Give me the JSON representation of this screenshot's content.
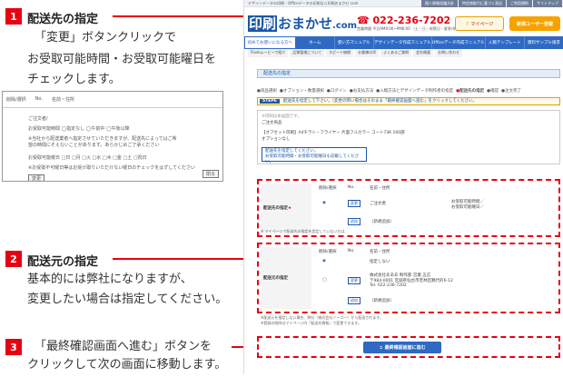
{
  "annotations": [
    {
      "num": "1",
      "title": "配送先の指定",
      "lines": [
        "「変更」ボタンクリックで",
        "お受取可能時間・お受取可能曜日を",
        "チェックします。"
      ]
    },
    {
      "num": "2",
      "title": "配送元の指定",
      "lines": [
        "基本的には弊社になりますが、",
        "変更したい場合は指定してください。"
      ]
    },
    {
      "num": "3",
      "title": "",
      "lines": [
        "「最終確認画面へ進む」ボタンを",
        "クリックして次の画面に移動します。"
      ]
    }
  ],
  "inset": {
    "col1": "削除/選択",
    "col2": "No.",
    "col3": "名前・住所",
    "row1": "ご注文者/",
    "row2": "お受取可能時間 ◯指定なし ◯午前中 ◯午後以降",
    "row3": "※当社から配送業者へ指定させていただきますが、配送先によってはご希望の時間にそえないことがあります。あらかじめご了承ください",
    "row4": "お受取可能曜日 □日 □月 □火 □水 □木 □金 □土 □祝日",
    "row5": "※お受取不可曜日等はお受け取りいただけない曜日のチェックをはずしてください",
    "btn_change": "変更",
    "btn_close": "閉る"
  },
  "shot": {
    "topbar_text": "デザインデータの印刷・Officeデータの印刷なら印刷おまかせ.com",
    "toplinks": [
      "個人情報保護方針",
      "特定商取引に基づく表記",
      "ご利用規約",
      "サイトマップ"
    ],
    "logo_box": "印刷",
    "logo_text": "おまかせ",
    "logo_tld": ".com",
    "tel": "022-236-7202",
    "tel_sub": "営業時間 平日AM9:00~PM6:00 （土・日・祝祭日・夏季/年末年始休業を除く）",
    "mypage": "マイページ",
    "register": "新規ユーザー登録",
    "nav": [
      "初めてお使いになる方へ",
      "ホーム",
      "使い方マニュアル",
      "デザインデータ作成マニュアル",
      "Officeデータ作成マニュアル",
      "入稿テンプレート",
      "資料サンプル請求"
    ],
    "subnav": [
      "Flashムービーで紹介",
      "品質管理について",
      "スピード納期",
      "お客様の声",
      "よくあるご質問",
      "会社概要",
      "お問い合わせ"
    ],
    "section_title": "配送先の指定",
    "steps": [
      "商品選択",
      "オプション・数量選択",
      "ログイン",
      "お支払方法",
      "入稿方法とデザインデータ制作者の指定",
      "配送先の指定",
      "確認",
      "注文完了"
    ],
    "step_current_index": 5,
    "step_label": "STEP6",
    "step_text": "配送先を指定して下さい。（変更の際い場合はそのまま「最終確認画面へ進む」をクリックしてください。",
    "prod_note": "※印刷は本画面です。",
    "prod_label": "ご注文商品",
    "prod_line1": "【オフセット印刷】A4チラシ・フライヤー 片面フルカラー コート73K 100部",
    "prod_line2": "オプションなし",
    "warn1": "配送先を指定してください。",
    "warn2": "お受取可能時間・お受取可能曜日も記載してください。",
    "dest_label": "配送先の指定",
    "dest_col1": "削除/選択",
    "dest_col2": "No.",
    "dest_col3": "名前・住所",
    "dest_name": "ご注文者",
    "dest_time": "お受取可能時間／",
    "dest_day": "お受取可能曜日／",
    "change": "変更",
    "add": "追加",
    "add_note": "（新規追加）",
    "dest_note": "※ マイページで配送先の指定を設定していない方は、",
    "src_label": "配送元の指定",
    "src_none": "指定しない",
    "src_company": "株式会社あああ 制作部 営業 五広",
    "src_addr": "〒984-0001 宮城県仙台市若林区鶴代町6-12",
    "src_tel": "Tel. 022-236-7202",
    "src_note1": "※配送元を指定しない場合、弊社（株式会社ソーゴー）から配送されます。",
    "src_note2": "※登録の削除はマイページ内「配送先情報」で変更できます。",
    "confirm": "最終確認画面に進む"
  }
}
